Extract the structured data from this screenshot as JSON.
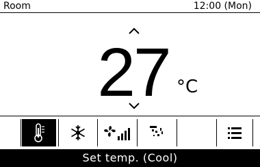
{
  "header": {
    "room_label": "Room",
    "clock": "12:00 (Mon)"
  },
  "temperature": {
    "value": "27",
    "unit": "°C"
  },
  "modes": [
    {
      "icon": "thermometer-icon",
      "active": true
    },
    {
      "icon": "snowflake-icon",
      "active": false
    },
    {
      "icon": "fan-speed-icon",
      "active": false
    },
    {
      "icon": "airflow-direction-icon",
      "active": false
    },
    {
      "icon": "blank",
      "active": false
    },
    {
      "icon": "menu-icon",
      "active": false
    }
  ],
  "status": {
    "text": "Set temp. (Cool)"
  },
  "colors": {
    "background": "#ffffff",
    "foreground": "#000000"
  }
}
